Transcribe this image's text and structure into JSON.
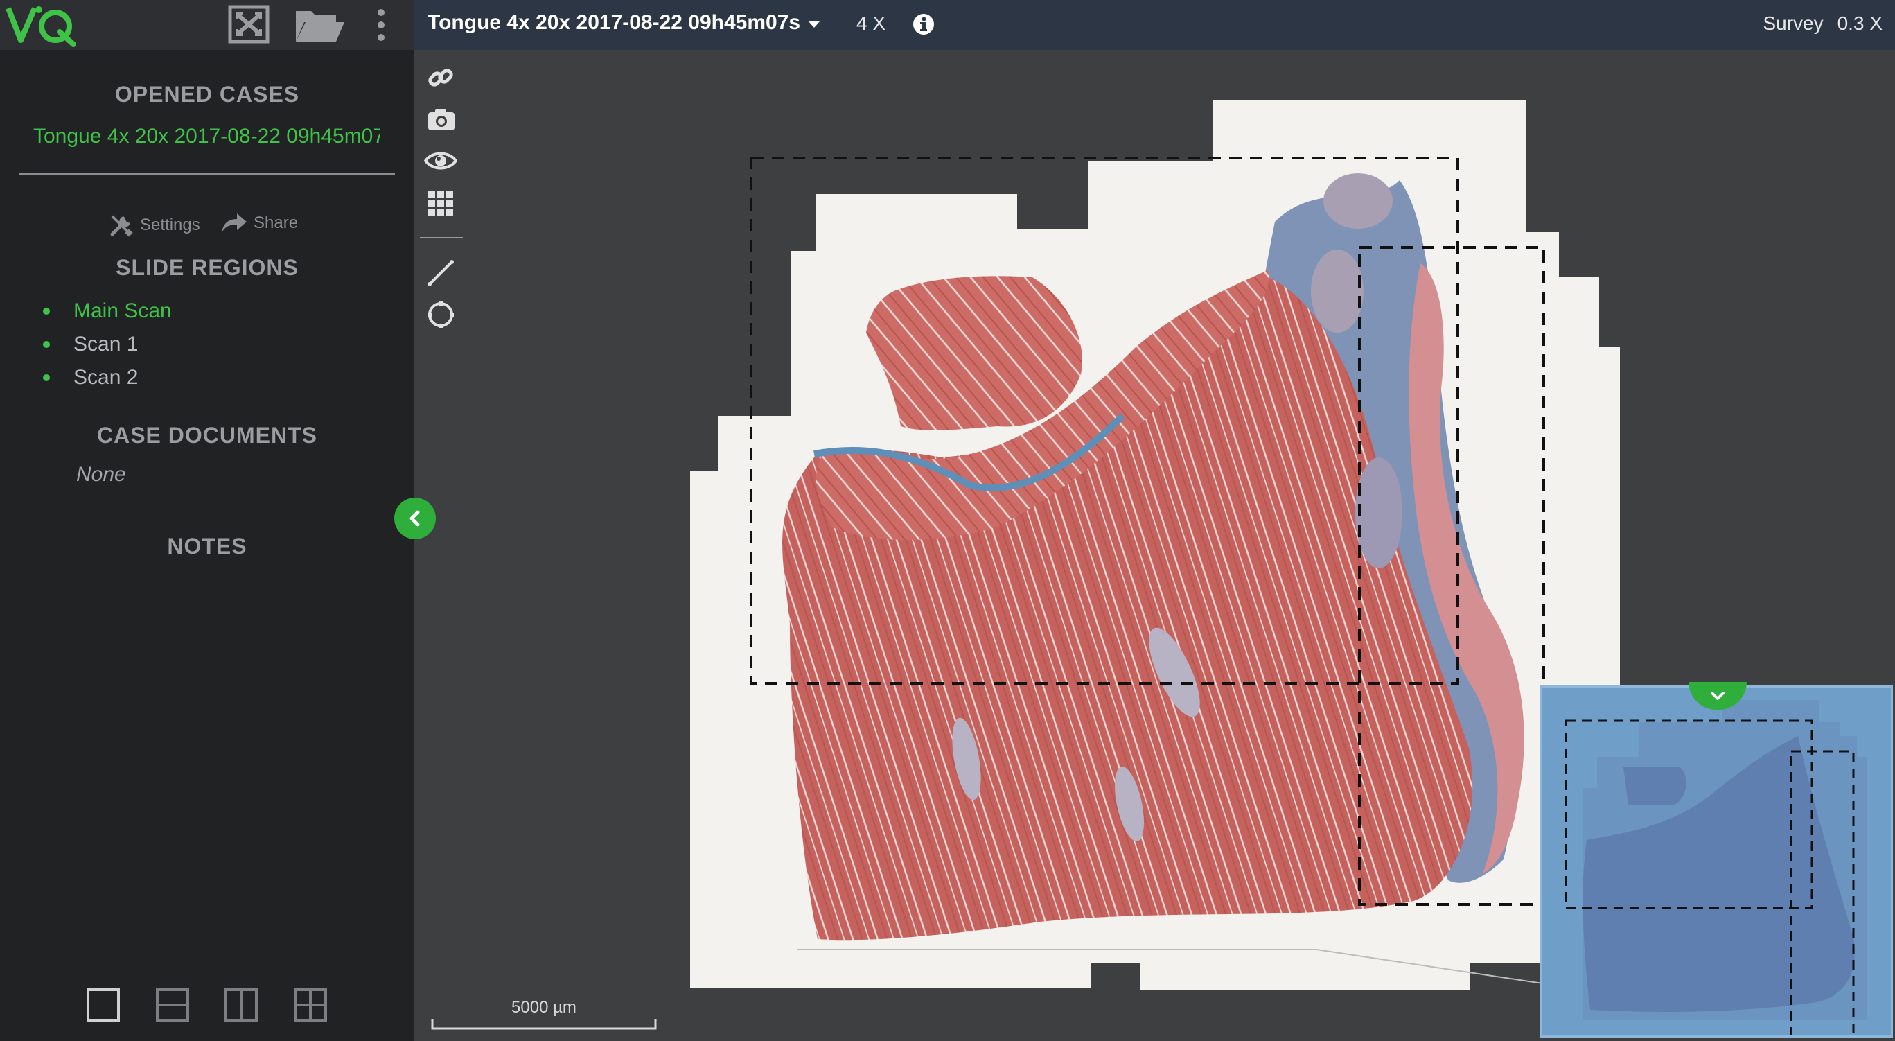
{
  "app": {
    "logo_text": "ViQ"
  },
  "sidebar": {
    "opened_cases_heading": "OPENED CASES",
    "opened_case": "Tongue 4x 20x 2017-08-22 09h45m07s",
    "settings_label": "Settings",
    "share_label": "Share",
    "slide_regions_heading": "SLIDE REGIONS",
    "regions": [
      {
        "label": "Main Scan",
        "active": true
      },
      {
        "label": "Scan 1",
        "active": false
      },
      {
        "label": "Scan 2",
        "active": false
      }
    ],
    "case_documents_heading": "CASE DOCUMENTS",
    "case_documents_empty": "None",
    "notes_heading": "NOTES",
    "layout_options": [
      "single-view-icon",
      "horizontal-split-icon",
      "vertical-split-icon",
      "quad-view-icon"
    ]
  },
  "topbar": {
    "slide_title": "Tongue 4x 20x 2017-08-22 09h45m07s",
    "magnification": "4 X",
    "survey_label": "Survey",
    "survey_zoom": "0.3 X"
  },
  "tools": [
    "link-icon",
    "camera-icon",
    "eye-icon",
    "grid-icon",
    "ruler-line-icon",
    "circle-annotation-icon"
  ],
  "viewer": {
    "scale_bar_label": "5000 µm"
  },
  "colors": {
    "accent": "#3ec247",
    "sidebar_bg": "#212224",
    "topbar_bg": "#2c3645",
    "viewer_bg": "#3e3f41",
    "tissue_muscle": "#c5655f",
    "tissue_connective": "#5a8fb8",
    "minimap_overlay": "#6f9fc9"
  }
}
